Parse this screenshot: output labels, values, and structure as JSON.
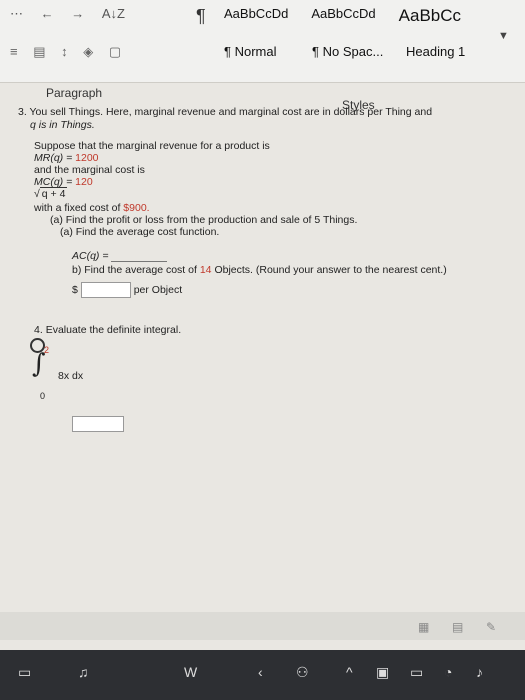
{
  "ribbon": {
    "tools_row1": [
      "⋯",
      "←",
      "→",
      "A↓Z"
    ],
    "tools_row2": [
      "≡",
      "▤",
      "↕",
      "◈",
      "▢"
    ],
    "styles": [
      {
        "preview": "AaBbCcDd",
        "name": "Normal"
      },
      {
        "preview": "AaBbCcDd",
        "name": "No Spac..."
      },
      {
        "preview": "AaBbCc",
        "name": "Heading 1"
      }
    ],
    "group_paragraph": "Paragraph",
    "group_styles": "Styles"
  },
  "doc": {
    "q3": {
      "number": "3.",
      "line1": "You sell Things. Here, marginal revenue and marginal cost are in dollars per Thing and",
      "line2": "q is in Things.",
      "suppose": "Suppose that the marginal revenue for a product is",
      "mr_label": "MR(q) =",
      "mr_value": "1200",
      "and_mc": "and the marginal cost is",
      "mc_label": "MC(q) =",
      "mc_value": "120",
      "sqrt": "q + 4",
      "fixed_pre": "with a fixed cost of",
      "fixed_value": "$900.",
      "part_a": "(a) Find the profit or loss from the production and sale of 5 Things.",
      "part_a2": "(a) Find the average cost function.",
      "ac_label": "AC(q) =",
      "part_b_pre": "b) Find the average cost of",
      "part_b_num": "14",
      "part_b_post": "Objects. (Round your answer to the nearest cent.)",
      "dollar": "$",
      "per_object": "per Object"
    },
    "q4": {
      "number": "4.",
      "text": "Evaluate the definite integral.",
      "upper": "2",
      "integrand": "8x dx",
      "lower": "0"
    }
  },
  "taskbar": {
    "items": [
      "task-view-icon",
      "music-icon",
      "word-icon",
      "people-icon",
      "chevron-up-icon",
      "display-icon",
      "battery-icon",
      "wifi-icon",
      "volume-icon"
    ]
  }
}
